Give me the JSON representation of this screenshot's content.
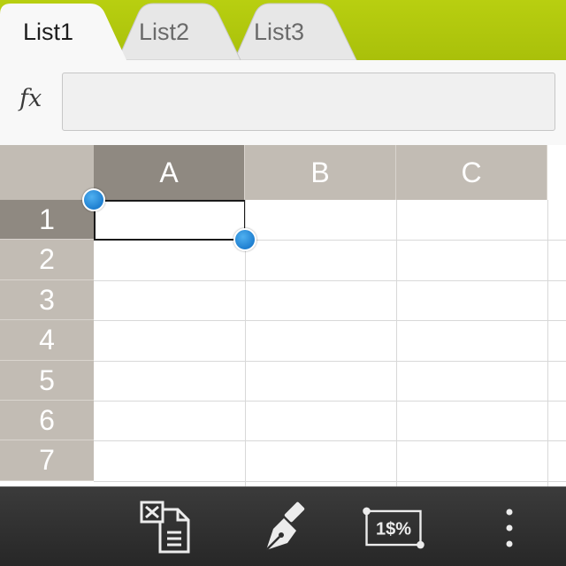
{
  "tabs": [
    {
      "label": "List1",
      "active": true
    },
    {
      "label": "List2",
      "active": false
    },
    {
      "label": "List3",
      "active": false
    }
  ],
  "formula_bar": {
    "label": "fx",
    "value": ""
  },
  "grid": {
    "columns": [
      "A",
      "B",
      "C"
    ],
    "rows": [
      "1",
      "2",
      "3",
      "4",
      "5",
      "6",
      "7"
    ],
    "selected_cell": "A1",
    "cells": {}
  },
  "toolbar": {
    "buttons": [
      {
        "name": "clear-cell-button",
        "icon": "clear-cell-icon"
      },
      {
        "name": "pen-button",
        "icon": "pen-nib-icon"
      },
      {
        "name": "number-format-button",
        "icon": "number-format-icon",
        "label": "1$%"
      },
      {
        "name": "overflow-menu-button",
        "icon": "more-vertical-icon"
      }
    ]
  },
  "colors": {
    "tab_bar": "#b2c80e",
    "header_bg": "#c2bcb4",
    "header_selected": "#8f8981",
    "selection_handle": "#2a8ee0",
    "toolbar_bg": "#2f2f2f"
  }
}
